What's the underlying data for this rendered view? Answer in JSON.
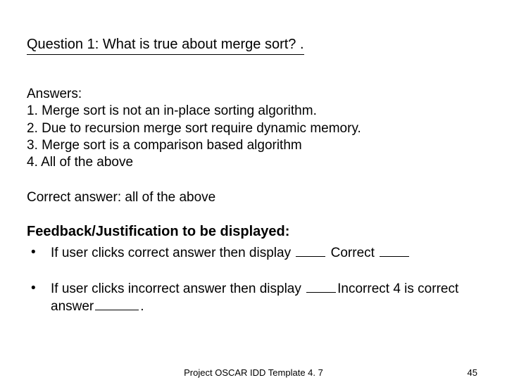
{
  "question": "Question 1: What is true about merge sort? .",
  "answers_label": "Answers:",
  "answers": [
    "1. Merge sort is not an in-place sorting algorithm.",
    "2. Due to recursion merge sort require dynamic memory.",
    "3. Merge sort is a comparison based algorithm",
    "4. All of the above"
  ],
  "correct": "Correct answer: all of the above",
  "feedback_heading": "Feedback/Justification to be displayed:",
  "bullet1_pre": "If user clicks correct answer then display ",
  "bullet1_mid": " Correct ",
  "bullet2_pre": "If user clicks incorrect answer then display ",
  "bullet2_mid": "Incorrect 4 is correct answer",
  "bullet2_post": ".",
  "footer_center": "Project OSCAR IDD Template 4. 7",
  "footer_right": "45"
}
